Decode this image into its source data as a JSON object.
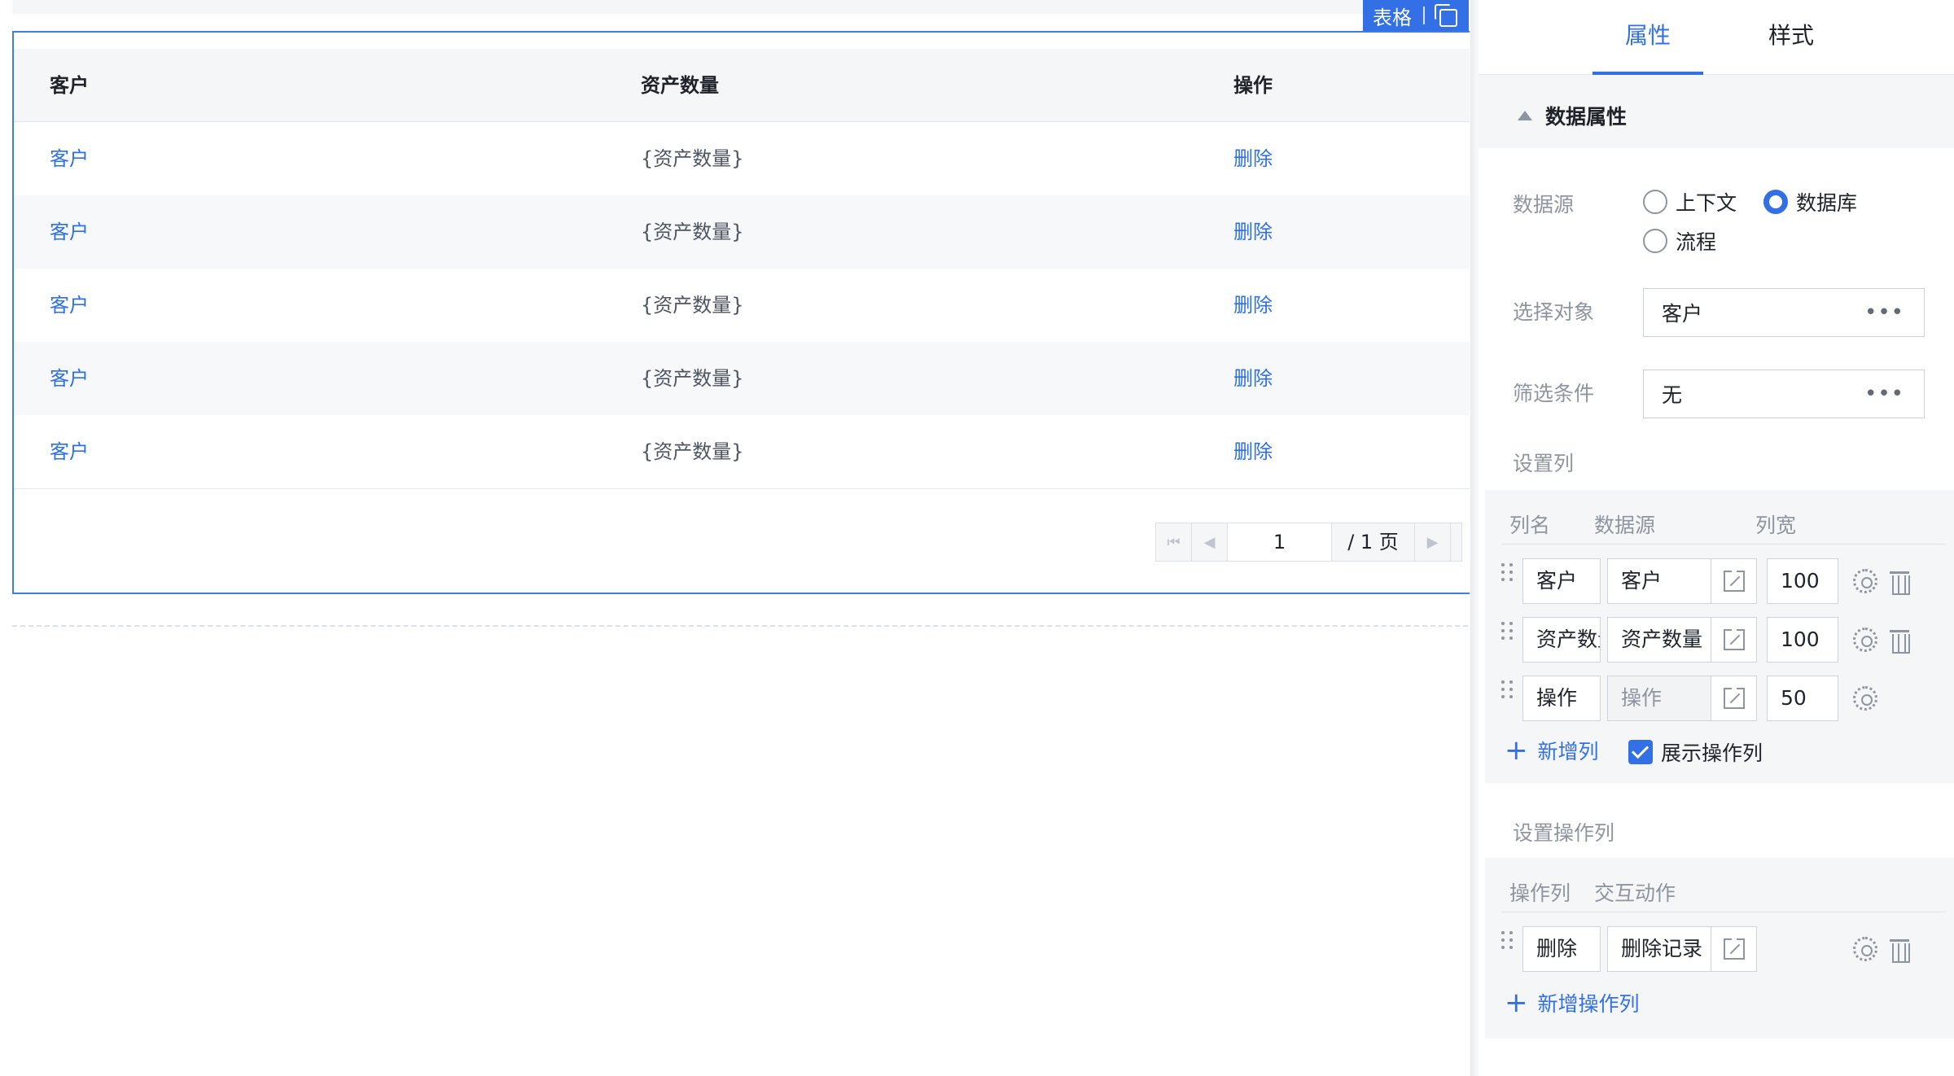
{
  "component_tag": {
    "label": "表格"
  },
  "table": {
    "headers": [
      "客户",
      "资产数量",
      "操作"
    ],
    "rows": [
      {
        "customer": "客户",
        "assets": "{资产数量}",
        "action": "删除"
      },
      {
        "customer": "客户",
        "assets": "{资产数量}",
        "action": "删除"
      },
      {
        "customer": "客户",
        "assets": "{资产数量}",
        "action": "删除"
      },
      {
        "customer": "客户",
        "assets": "{资产数量}",
        "action": "删除"
      },
      {
        "customer": "客户",
        "assets": "{资产数量}",
        "action": "删除"
      }
    ],
    "pagination": {
      "current_page": "1",
      "total_label": "/ 1 页"
    }
  },
  "panel": {
    "tabs": [
      "属性",
      "样式"
    ],
    "active_tab": "属性",
    "section_title": "数据属性",
    "data_source": {
      "label": "数据源",
      "options": [
        "上下文",
        "数据库",
        "流程"
      ],
      "selected": "数据库"
    },
    "object": {
      "label": "选择对象",
      "value": "客户"
    },
    "filter": {
      "label": "筛选条件",
      "value": "无"
    },
    "columns": {
      "label": "设置列",
      "headers": [
        "列名",
        "数据源",
        "列宽"
      ],
      "items": [
        {
          "name": "客户",
          "source": "客户",
          "width": "100",
          "source_disabled": false
        },
        {
          "name": "资产数量",
          "source": "资产数量",
          "width": "100",
          "source_disabled": false
        },
        {
          "name": "操作",
          "source": "操作",
          "width": "50",
          "source_disabled": true
        }
      ],
      "add_label": "新增列",
      "show_action_label": "展示操作列",
      "show_action_checked": true
    },
    "action_columns": {
      "label": "设置操作列",
      "headers": [
        "操作列",
        "交互动作"
      ],
      "items": [
        {
          "name": "删除",
          "action": "删除记录"
        }
      ],
      "add_label": "新增操作列"
    }
  },
  "colors": {
    "accent": "#3370e6",
    "link": "#2f6fe4"
  }
}
